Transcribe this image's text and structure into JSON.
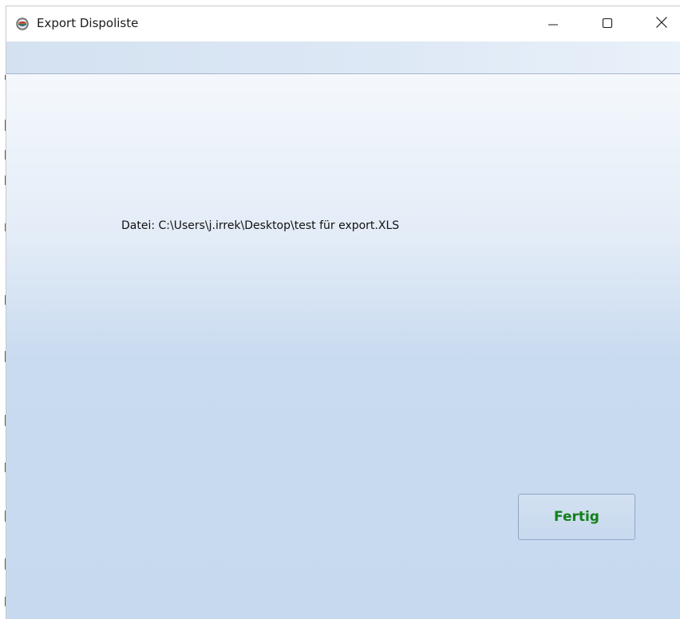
{
  "window": {
    "title": "Export Dispoliste",
    "app_icon": "app-logo-icon",
    "controls": {
      "minimize_icon": "minimize-icon",
      "maximize_icon": "maximize-icon",
      "close_icon": "close-icon"
    }
  },
  "content": {
    "file_label": "Datei: C:\\Users\\j.irrek\\Desktop\\test für export.XLS",
    "finish_button_label": "Fertig"
  },
  "colors": {
    "finish_text": "#11801a",
    "content_gradient_top": "#f4f8fc",
    "content_gradient_bottom": "#c6d9ef"
  }
}
